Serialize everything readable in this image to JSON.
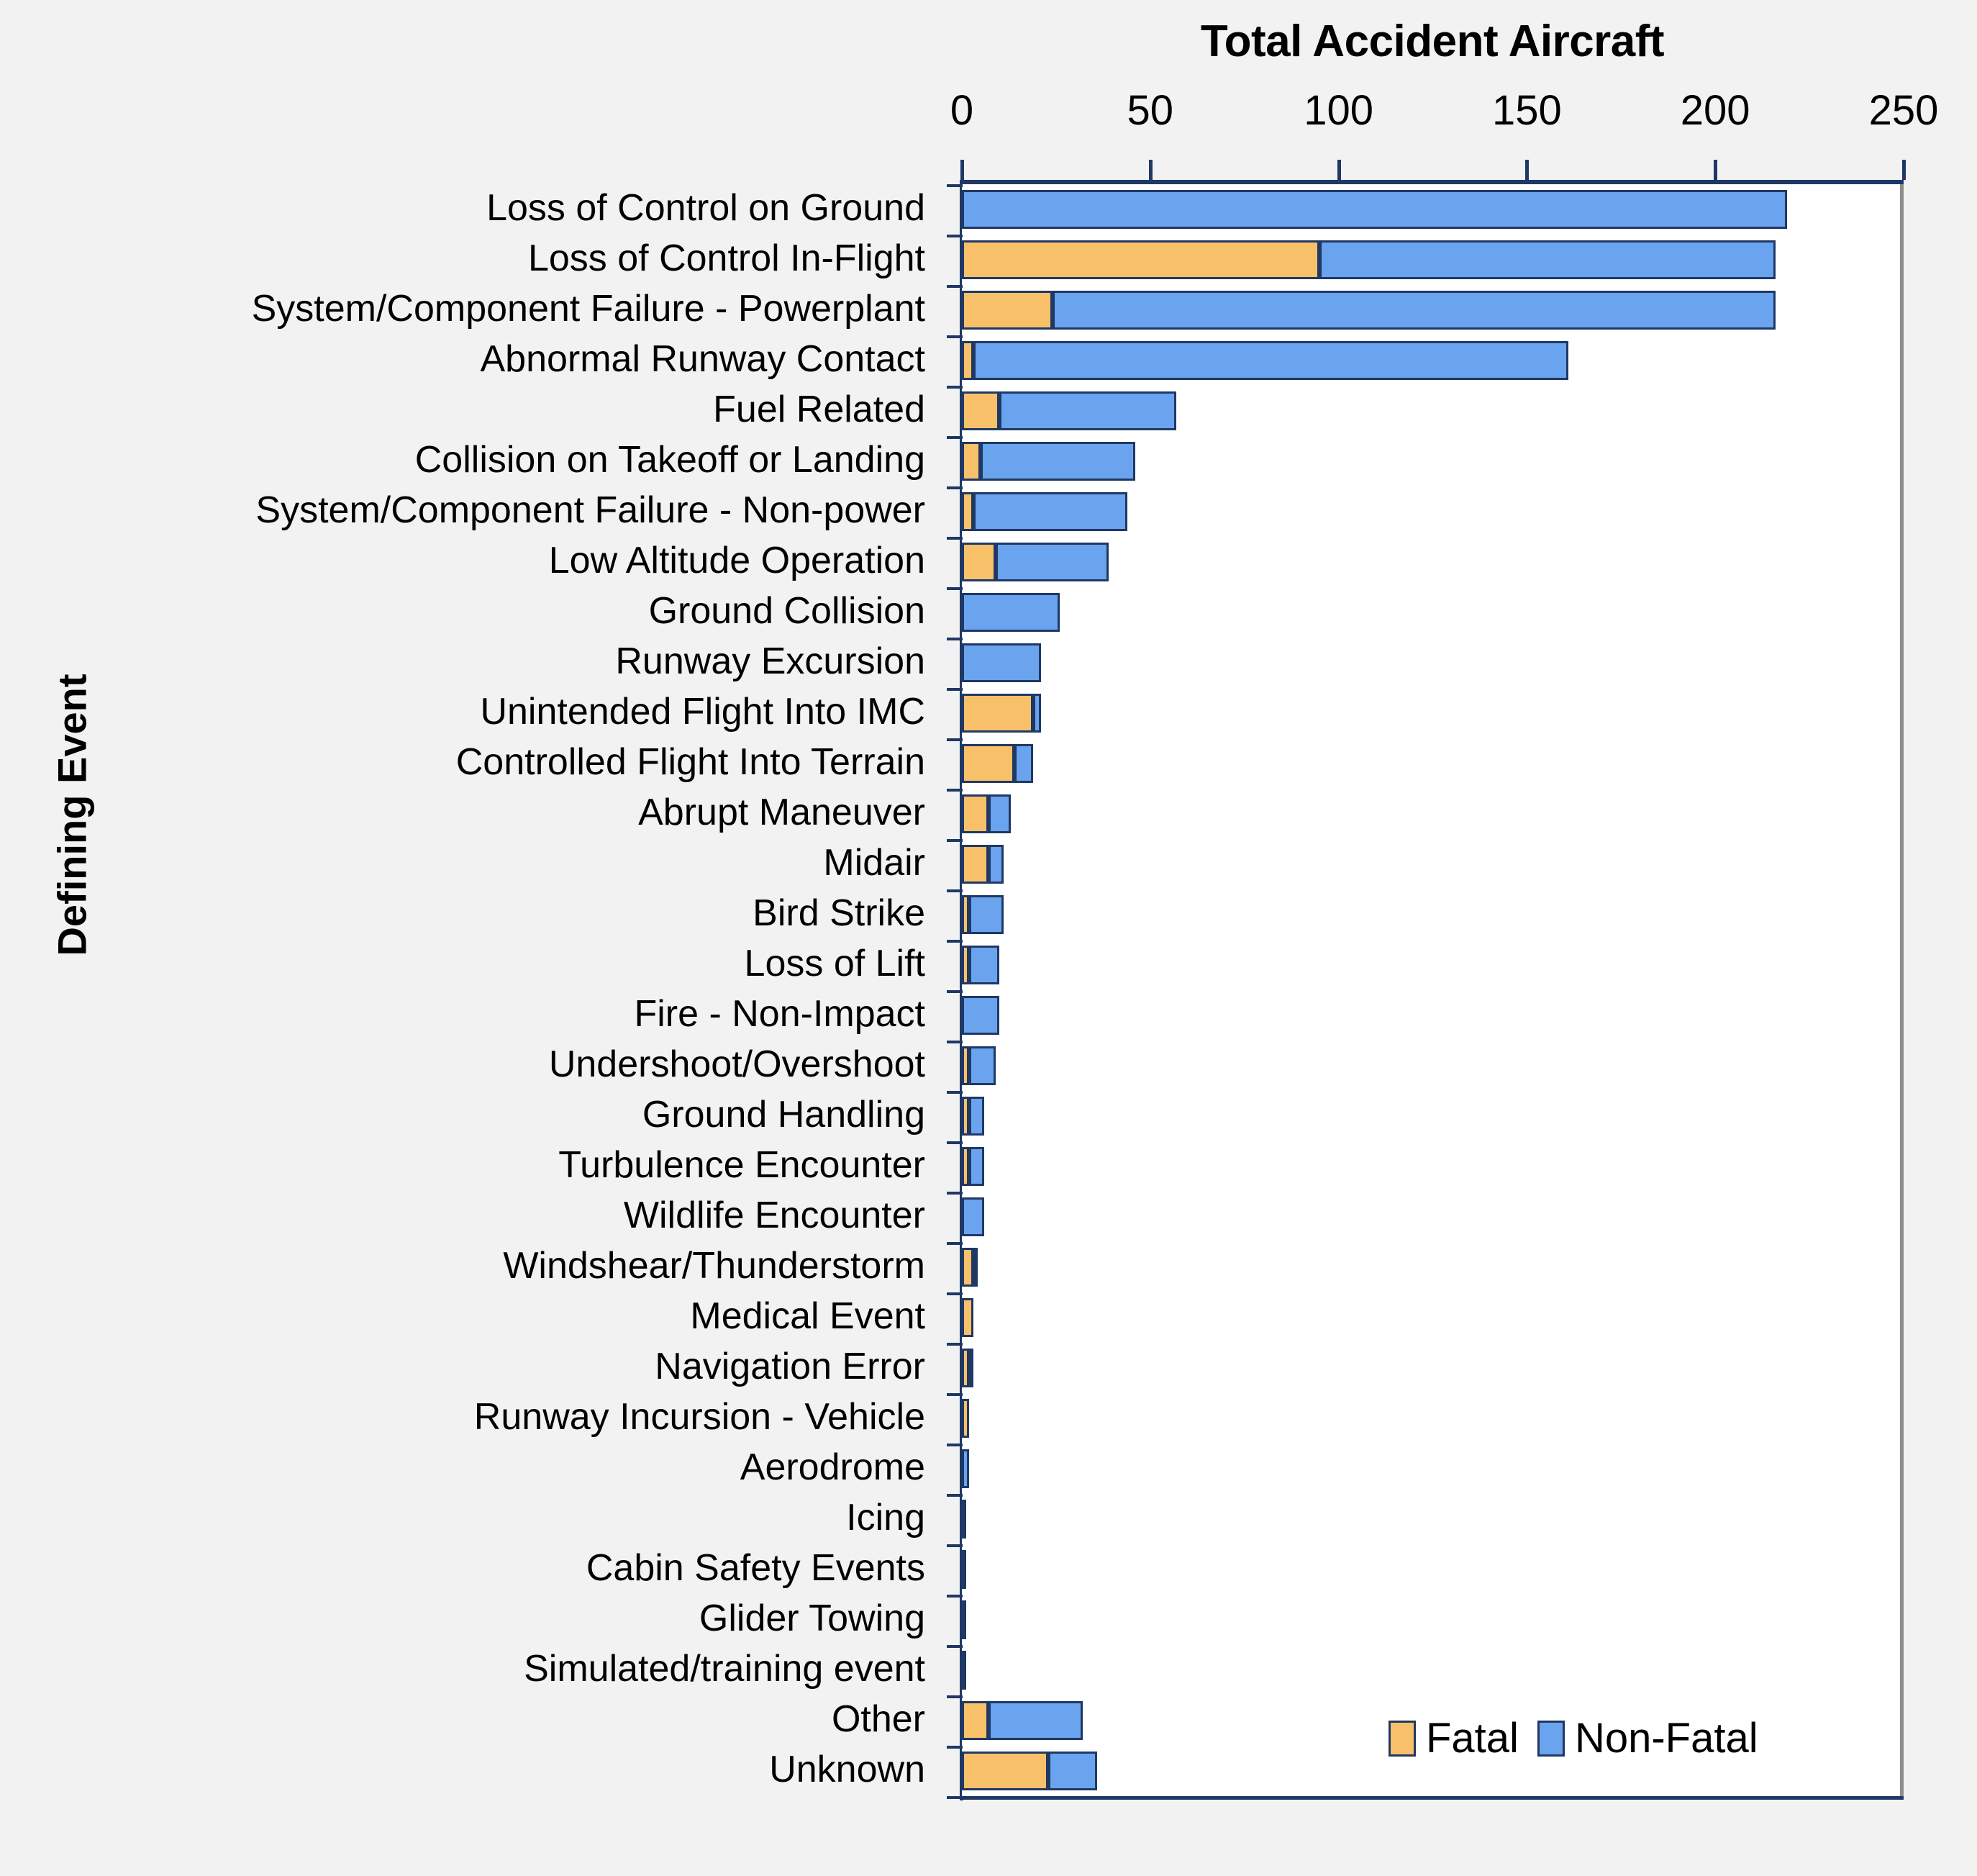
{
  "chart_data": {
    "type": "bar",
    "orientation": "horizontal",
    "stacked": true,
    "title": "Total Accident Aircraft",
    "xlabel": "Total Accident Aircraft",
    "ylabel": "Defining Event",
    "xlim": [
      0,
      250
    ],
    "xticks": [
      0,
      50,
      100,
      150,
      200,
      250
    ],
    "xtick_labels": [
      "0",
      "50",
      "100",
      "150",
      "200",
      "250"
    ],
    "grid": false,
    "legend_position": "bottom-right",
    "colors": {
      "fatal": "#f9c06a",
      "non_fatal": "#6aa3ee",
      "outline": "#1f3864",
      "background": "#f2f2f2",
      "plot_background": "#ffffff"
    },
    "legend": [
      {
        "name": "Fatal",
        "color": "#f9c06a"
      },
      {
        "name": "Non-Fatal",
        "color": "#6aa3ee"
      }
    ],
    "categories": [
      "Loss of Control on Ground",
      "Loss of Control In-Flight",
      "System/Component Failure - Powerplant",
      "Abnormal Runway Contact",
      "Fuel Related",
      "Collision on Takeoff or Landing",
      "System/Component Failure - Non-power",
      "Low Altitude Operation",
      "Ground Collision",
      "Runway Excursion",
      "Unintended Flight Into IMC",
      "Controlled Flight Into Terrain",
      "Abrupt Maneuver",
      "Midair",
      "Bird Strike",
      "Loss of Lift",
      "Fire - Non-Impact",
      "Undershoot/Overshoot",
      "Ground Handling",
      "Turbulence Encounter",
      "Wildlife Encounter",
      "Windshear/Thunderstorm",
      "Medical Event",
      "Navigation Error",
      "Runway Incursion - Vehicle",
      "Aerodrome",
      "Icing",
      "Cabin Safety Events",
      "Glider Towing",
      "Simulated/training event",
      "Other",
      "Unknown"
    ],
    "series": [
      {
        "name": "Fatal",
        "color": "#f9c06a",
        "values": [
          0,
          95,
          24,
          3,
          10,
          5,
          3,
          9,
          0,
          0,
          19,
          14,
          7,
          7,
          2,
          2,
          0,
          2,
          2,
          2,
          0,
          3,
          3,
          2,
          2,
          0,
          1,
          0,
          0,
          0,
          7,
          23
        ]
      },
      {
        "name": "Non-Fatal",
        "color": "#6aa3ee",
        "values": [
          219,
          121,
          192,
          158,
          47,
          41,
          41,
          30,
          26,
          21,
          2,
          5,
          6,
          4,
          9,
          8,
          10,
          7,
          4,
          4,
          6,
          1,
          0,
          1,
          0,
          2,
          0,
          1,
          1,
          1,
          25,
          13
        ]
      }
    ],
    "totals": [
      219,
      216,
      216,
      161,
      57,
      46,
      44,
      39,
      26,
      21,
      21,
      19,
      13,
      11,
      11,
      10,
      10,
      9,
      6,
      6,
      6,
      4,
      3,
      3,
      2,
      2,
      1,
      1,
      1,
      1,
      32,
      36
    ]
  }
}
